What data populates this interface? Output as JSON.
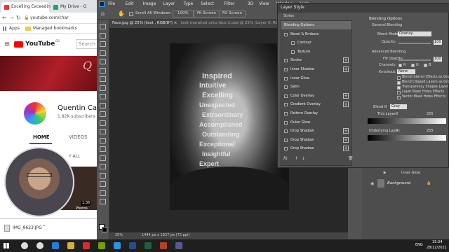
{
  "chrome": {
    "tab1": "Excelling Exceedin",
    "tab2": "My Drive - G",
    "address": "youtube.com/char",
    "bookmarks": {
      "apps": "Apps",
      "managed": "Managed bookmarks"
    }
  },
  "youtube": {
    "logo": "YouTube",
    "logo_sup": "GB",
    "search_placeholder": "Search",
    "channel_name": "Quentin Ca",
    "subscribers": "1.82K subscribers",
    "tabs": [
      "HOME",
      "VIDEOS"
    ],
    "play_all": "Y ALL",
    "video_time": "1:36",
    "video_caption": "Photos"
  },
  "downloads": {
    "file": "IMG_8623.JPG"
  },
  "photoshop": {
    "menu": [
      "File",
      "Edit",
      "Image",
      "Layer",
      "Type",
      "Select",
      "Filter",
      "3D",
      "View",
      "Window",
      "Help"
    ],
    "options": {
      "scroll_all": "Scroll All Windows",
      "zoom": "100%",
      "fit_screen": "Fit Screen",
      "fill_screen": "Fill Screen"
    },
    "doc_tab_active": "Face.jpg @ 25% (text , RGB/8*) ×",
    "doc_tab_inactive": "text morphed onto face 2.psd @ 25% (Layer 0, RGB/8*) ×",
    "status_zoom": "25%",
    "status_info": "1444 px x 1927 px (72 ppi)",
    "face_words": [
      "Inspired",
      "Intuitive",
      "Excelling",
      "Unexpected",
      "Extraordinary",
      "Accomplished",
      "Outstanding",
      "Exceptional",
      "Insightful",
      "Expert"
    ],
    "layers": {
      "effects": "Effects",
      "inner_glow": "Inner Glow",
      "background": "Background"
    }
  },
  "layer_style": {
    "title": "Layer Style",
    "styles_header": "Styles",
    "items": [
      {
        "label": "Blending Options",
        "selected": true,
        "checkbox": false,
        "plus": false
      },
      {
        "label": "Bevel & Emboss",
        "checkbox": true,
        "plus": false
      },
      {
        "label": "Contour",
        "checkbox": true,
        "plus": false,
        "indent": true
      },
      {
        "label": "Texture",
        "checkbox": true,
        "plus": false,
        "indent": true
      },
      {
        "label": "Stroke",
        "checkbox": true,
        "plus": true
      },
      {
        "label": "Inner Shadow",
        "checkbox": true,
        "plus": true
      },
      {
        "label": "Inner Glow",
        "checkbox": true,
        "plus": false
      },
      {
        "label": "Satin",
        "checkbox": true,
        "plus": false
      },
      {
        "label": "Color Overlay",
        "checkbox": true,
        "plus": true
      },
      {
        "label": "Gradient Overlay",
        "checkbox": true,
        "plus": true
      },
      {
        "label": "Pattern Overlay",
        "checkbox": true,
        "plus": false
      },
      {
        "label": "Outer Glow",
        "checkbox": true,
        "plus": false
      },
      {
        "label": "Drop Shadow",
        "checkbox": true,
        "plus": true
      },
      {
        "label": "Drop Shadow",
        "checkbox": true,
        "plus": true
      },
      {
        "label": "Drop Shadow",
        "checkbox": true,
        "plus": true
      }
    ],
    "fx_label": "fx",
    "blending": {
      "header": "Blending Options",
      "general": "General Blending",
      "blend_mode_label": "Blend Mode:",
      "blend_mode_value": "Overlay",
      "opacity_label": "Opacity:",
      "opacity_value": "100",
      "advanced": "Advanced Blending",
      "fill_opacity_label": "Fill Opacity:",
      "fill_opacity_value": "100",
      "channels_label": "Channels:",
      "channels": [
        "R",
        "G",
        "B"
      ],
      "knockout_label": "Knockout:",
      "knockout_value": "None",
      "checks": [
        "Blend Interior Effects as Group",
        "Blend Clipped Layers as Group",
        "Transparency Shapes Layer",
        "Layer Mask Hides Effects",
        "Vector Mask Hides Effects"
      ],
      "blend_if_label": "Blend If:",
      "blend_if_value": "Gray",
      "this_layer_label": "This Layer:",
      "this_layer_min": "0",
      "this_layer_max": "255",
      "underlying_label": "Underlying Layer:",
      "underlying_min": "0",
      "underlying_max": "255"
    }
  },
  "taskbar": {
    "lang": "ENG",
    "time": "19:34",
    "date": "28/12/2021"
  },
  "colors": {
    "ps_bg": "#535353",
    "yt_red": "#ff0000",
    "selected": "#5a5a5a"
  }
}
